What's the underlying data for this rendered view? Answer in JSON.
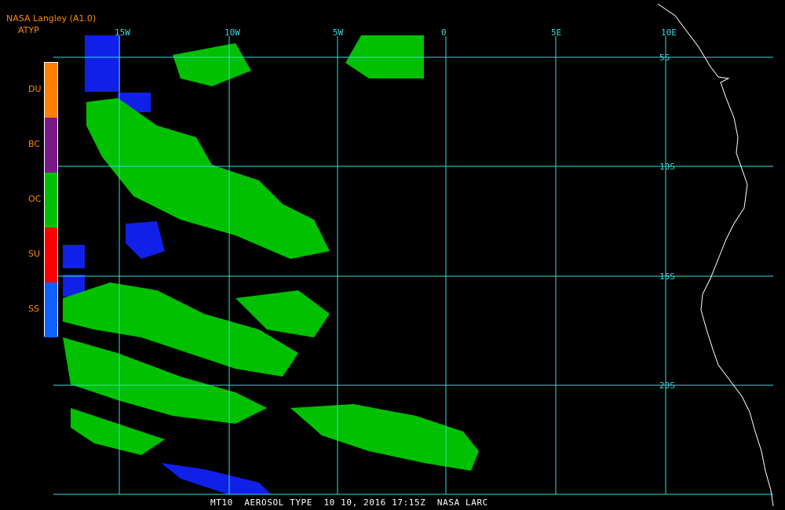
{
  "header": {
    "title": "NASA Langley (A1.0)",
    "subtitle": "ATYP"
  },
  "legend": [
    {
      "label": "DU",
      "color": "#ff8000"
    },
    {
      "label": "BC",
      "color": "#7a1a8a"
    },
    {
      "label": "OC",
      "color": "#00c000"
    },
    {
      "label": "SU",
      "color": "#ff0000"
    },
    {
      "label": "SS",
      "color": "#1060ff"
    }
  ],
  "grid": {
    "longitudes": [
      "15W",
      "10W",
      "5W",
      "0",
      "5E",
      "10E"
    ],
    "latitudes": [
      "5S",
      "10S",
      "15S",
      "20S"
    ],
    "color": "#33dddd"
  },
  "footer": {
    "caption": "MT10  AEROSOL TYPE  10 10, 2016 17:15Z  NASA LARC"
  }
}
